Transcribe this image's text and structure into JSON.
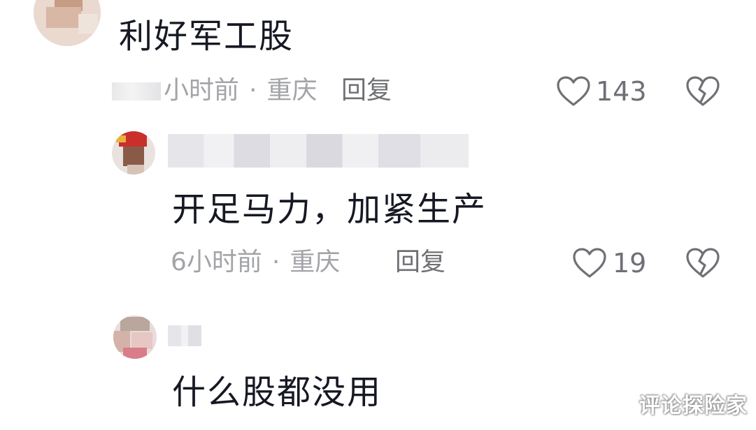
{
  "comments": [
    {
      "text": "利好军工股",
      "time": "小时前",
      "location": "重庆",
      "reply_label": "回复",
      "likes": "143"
    },
    {
      "text": "开足马力，加紧生产",
      "time": "6小时前",
      "location": "重庆",
      "reply_label": "回复",
      "likes": "19"
    },
    {
      "text": "什么股都没用"
    }
  ],
  "separator": "·",
  "icons": {
    "like": "heart-outline-icon",
    "dislike": "broken-heart-icon"
  },
  "colors": {
    "text": "#161823",
    "meta": "#a3a4a8",
    "action": "#6f7075"
  },
  "watermark": "评论探险家"
}
